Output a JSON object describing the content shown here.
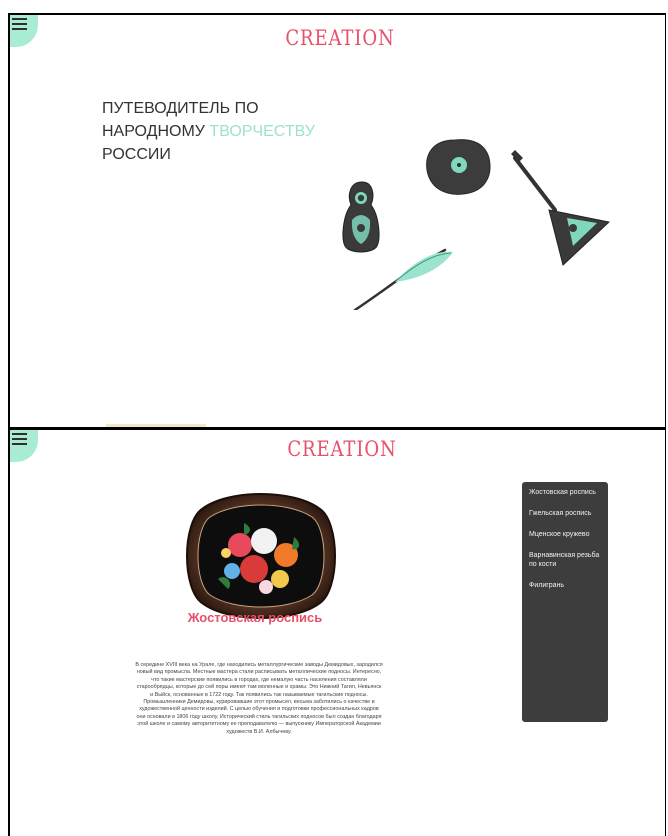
{
  "brand": {
    "logo_text": "CREATION",
    "accent_color": "#e8506a",
    "mint_color": "#a7ecd3",
    "dark_panel_color": "#3d3d3d"
  },
  "screen1": {
    "menu_icon": "hamburger-menu-icon",
    "hero": {
      "line1": "ПУТЕВОДИТЕЛЬ ПО",
      "line2_start": "НАРОДНОМУ ",
      "line2_accent": "ТВОРЧЕСТВУ",
      "line3": "РОССИИ"
    },
    "illustration_items": [
      "matryoshka-icon",
      "vinyl-record-icon",
      "balalaika-icon",
      "feather-quill-icon"
    ]
  },
  "screen2": {
    "menu_icon": "hamburger-menu-icon",
    "side_menu": [
      {
        "label": "Жостовская роспись"
      },
      {
        "label": "Гжельская роспись"
      },
      {
        "label": "Мценское кружево"
      },
      {
        "label": "Варнавинская резьба по кости"
      },
      {
        "label": "Филигрань"
      }
    ],
    "article": {
      "title": "Жостовская роспись",
      "image": "zhostovo-tray-image",
      "body": "В середине XVIII века на Урале, где находились металлургические заводы Демидовых, зародился новый вид промысла. Местные мастера стали расписывать металлические подносы. Интересно, что такие мастерские появились в городах, где немалую часть населения составляли старообрядцы, которые до сей поры имеют там моленные и храмы. Это Нижний Тагил, Невьянск и Выйск, основанные в 1722 году. Так появились так называемые тагильские подносы. Промышленники Демидовы, курировавшие этот промысел, весьма заботились о качестве и художественной ценности изделий. С целью обучения и подготовки профессиональных кадров они основали в 1806 году школу. Исторический стиль тагильских подносов был создан благодаря этой школе и самому авторитетному ее преподавателю — выпускнику Императорской Академии художеств В.И. Албычеву."
    }
  }
}
